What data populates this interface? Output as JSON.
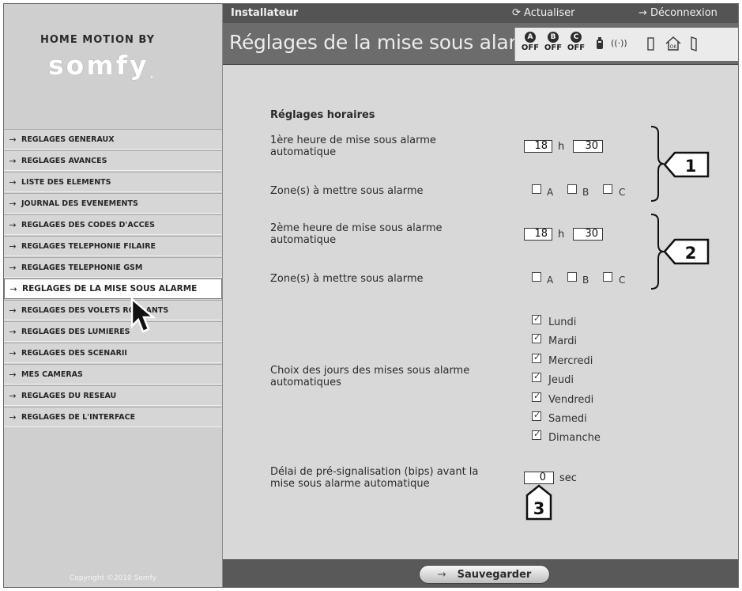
{
  "brand": {
    "by": "HOME MOTION BY",
    "name": "somfy",
    "mark": "®"
  },
  "topbar": {
    "role": "Installateur",
    "refresh": "Actualiser",
    "logout": "Déconnexion"
  },
  "page_title": "Réglages de la mise sous alarme",
  "status": {
    "zones": [
      {
        "letter": "A",
        "state": "OFF"
      },
      {
        "letter": "B",
        "state": "OFF"
      },
      {
        "letter": "C",
        "state": "OFF"
      }
    ],
    "icons": [
      "battery-icon",
      "signal-icon",
      "door-sensor-icon",
      "home-ok-icon",
      "door-icon"
    ],
    "home_ok": "OK"
  },
  "menu": [
    {
      "label": "REGLAGES GENERAUX",
      "active": false
    },
    {
      "label": "REGLAGES AVANCES",
      "active": false
    },
    {
      "label": "LISTE DES ELEMENTS",
      "active": false
    },
    {
      "label": "JOURNAL DES EVENEMENTS",
      "active": false
    },
    {
      "label": "REGLAGES DES CODES D'ACCES",
      "active": false
    },
    {
      "label": "REGLAGES TELEPHONIE FILAIRE",
      "active": false
    },
    {
      "label": "REGLAGES TELEPHONIE GSM",
      "active": false
    },
    {
      "label": "REGLAGES DE LA MISE SOUS ALARME",
      "active": true
    },
    {
      "label": "REGLAGES DES VOLETS ROULANTS",
      "active": false
    },
    {
      "label": "REGLAGES DES LUMIERES",
      "active": false
    },
    {
      "label": "REGLAGES DES SCENARII",
      "active": false
    },
    {
      "label": "MES CAMERAS",
      "active": false
    },
    {
      "label": "REGLAGES DU RESEAU",
      "active": false
    },
    {
      "label": "REGLAGES DE L'INTERFACE",
      "active": false
    }
  ],
  "copyright": "Copyright ©2010 Somfy",
  "form": {
    "section_title": "Réglages horaires",
    "first": {
      "label_line1": "1ère heure de mise sous alarme",
      "label_line2": "automatique",
      "hour": "18",
      "h": "h",
      "minute": "30",
      "zone_label": "Zone(s) à mettre sous alarme",
      "zones": [
        {
          "label": "A",
          "checked": false
        },
        {
          "label": "B",
          "checked": false
        },
        {
          "label": "C",
          "checked": false
        }
      ]
    },
    "second": {
      "label_line1": "2ème heure de mise sous alarme",
      "label_line2": "automatique",
      "hour": "18",
      "h": "h",
      "minute": "30",
      "zone_label": "Zone(s) à mettre sous alarme",
      "zones": [
        {
          "label": "A",
          "checked": false
        },
        {
          "label": "B",
          "checked": false
        },
        {
          "label": "C",
          "checked": false
        }
      ]
    },
    "days_label_line1": "Choix des jours des mises sous alarme",
    "days_label_line2": "automatiques",
    "days": [
      {
        "label": "Lundi",
        "checked": true
      },
      {
        "label": "Mardi",
        "checked": true
      },
      {
        "label": "Mercredi",
        "checked": true
      },
      {
        "label": "Jeudi",
        "checked": true
      },
      {
        "label": "Vendredi",
        "checked": true
      },
      {
        "label": "Samedi",
        "checked": true
      },
      {
        "label": "Dimanche",
        "checked": true
      }
    ],
    "delay_label_line1": "Délai de pré-signalisation (bips) avant la",
    "delay_label_line2": "mise sous alarme automatique",
    "delay_value": "0",
    "delay_unit": "sec"
  },
  "callouts": [
    "1",
    "2",
    "3"
  ],
  "save_label": "Sauvegarder"
}
